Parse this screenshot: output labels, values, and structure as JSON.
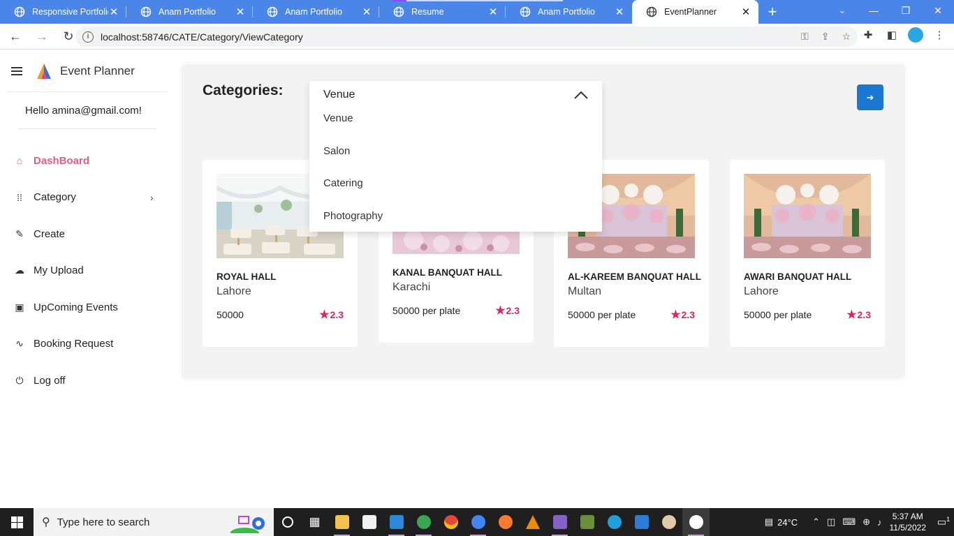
{
  "browser": {
    "tabs": [
      {
        "title": "Responsive Portfolio W",
        "active": false
      },
      {
        "title": "Anam Portfolio",
        "active": false
      },
      {
        "title": "Anam Portfolio",
        "active": false
      },
      {
        "title": "Resume",
        "active": false
      },
      {
        "title": "Anam Portfolio",
        "active": false
      },
      {
        "title": "EventPlanner",
        "active": true
      }
    ],
    "url": "localhost:58746/CATE/Category/ViewCategory",
    "accent": "#4a86e8"
  },
  "sidebar": {
    "brand": "Event Planner",
    "greeting": "Hello amina@gmail.com!",
    "items": [
      {
        "label": "DashBoard",
        "icon": "home-icon",
        "active": true
      },
      {
        "label": "Category",
        "icon": "grid-dots-icon",
        "active": false
      },
      {
        "label": "Create",
        "icon": "pen-icon",
        "active": false
      },
      {
        "label": "My Upload",
        "icon": "cloud-upload-icon",
        "active": false
      },
      {
        "label": "UpComing Events",
        "icon": "calendar-icon",
        "active": false
      },
      {
        "label": "Booking Request",
        "icon": "wave-icon",
        "active": false
      },
      {
        "label": "Log off",
        "icon": "power-icon",
        "active": false
      }
    ],
    "active_color": "#e0607e"
  },
  "main": {
    "title": "Categories:",
    "dropdown": {
      "selected": "Venue",
      "options": [
        "Venue",
        "Salon",
        "Catering",
        "Photography"
      ]
    },
    "cards": [
      {
        "name": "ROYAL HALL",
        "city": "Lahore",
        "price": "50000",
        "rating": "2.3"
      },
      {
        "name": "KANAL BANQUAT HALL",
        "city": "Karachi",
        "price": "50000 per plate",
        "rating": "2.3"
      },
      {
        "name": "AL-KAREEM BANQUAT HALL",
        "city": "Multan",
        "price": "50000 per plate",
        "rating": "2.3"
      },
      {
        "name": "AWARI BANQUAT HALL",
        "city": "Lahore",
        "price": "50000 per plate",
        "rating": "2.3"
      }
    ],
    "rating_color": "#e0245e",
    "button_color": "#1976d2"
  },
  "taskbar": {
    "search_placeholder": "Type here to search",
    "temperature": "24°C",
    "time": "5:37 AM",
    "date": "11/5/2022",
    "notifications": "1"
  }
}
